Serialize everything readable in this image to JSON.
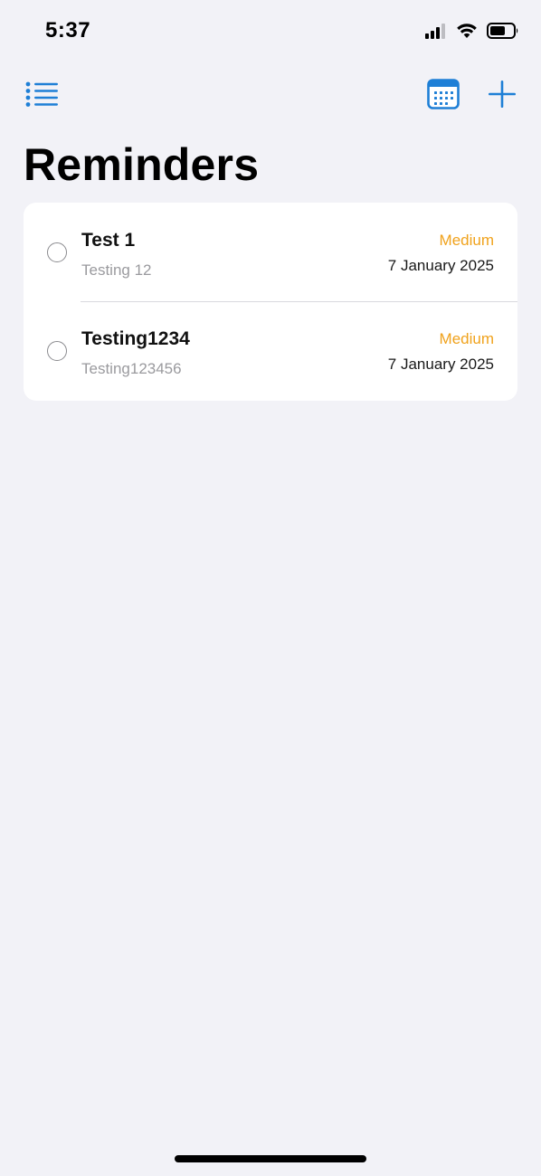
{
  "status_bar": {
    "time": "5:37",
    "icons": [
      "cellular-signal-icon",
      "wifi-icon",
      "battery-icon"
    ]
  },
  "nav": {
    "left_icon": "list-icon",
    "right_icons": [
      "calendar-icon",
      "plus-icon"
    ]
  },
  "page": {
    "title": "Reminders"
  },
  "reminders": [
    {
      "title": "Test 1",
      "notes": "Testing 12",
      "priority": "Medium",
      "date": "7 January 2025"
    },
    {
      "title": "Testing1234",
      "notes": "Testing123456",
      "priority": "Medium",
      "date": "7 January 2025"
    }
  ],
  "colors": {
    "accent": "#1e7fd6",
    "priority_medium": "#f0a21c",
    "background": "#f2f2f7"
  }
}
